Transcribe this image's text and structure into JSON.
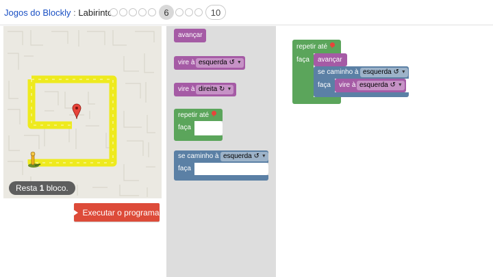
{
  "header": {
    "app_title": "Jogos do Blockly",
    "separator": " : ",
    "game_title": "Labirinto",
    "current_level": "6",
    "last_level": "10"
  },
  "maze": {
    "remaining_prefix": "Resta ",
    "remaining_count": "1",
    "remaining_suffix": " bloco."
  },
  "run_button": {
    "label": "Executar o programa"
  },
  "toolbox": {
    "move_forward": "avançar",
    "turn_left": {
      "label": "vire à",
      "value": "esquerda ↺"
    },
    "turn_right": {
      "label": "vire à",
      "value": "direita ↻"
    },
    "repeat_until": {
      "label": "repetir até",
      "do": "faça"
    },
    "if_path": {
      "label": "se caminho à",
      "value": "esquerda ↺",
      "do": "faça"
    }
  },
  "workspace": {
    "repeat_until": {
      "label": "repetir até",
      "do": "faça"
    },
    "move_forward": "avançar",
    "if_path": {
      "label": "se caminho à",
      "value": "esquerda ↺",
      "do": "faça"
    },
    "turn": {
      "label": "vire à",
      "value": "esquerda ↺"
    }
  },
  "colors": {
    "motion_block": "#a55ba5",
    "loop_block": "#5ba55b",
    "logic_block": "#5b80a5",
    "run_button": "#dd4b39",
    "path": "#f3f000"
  }
}
